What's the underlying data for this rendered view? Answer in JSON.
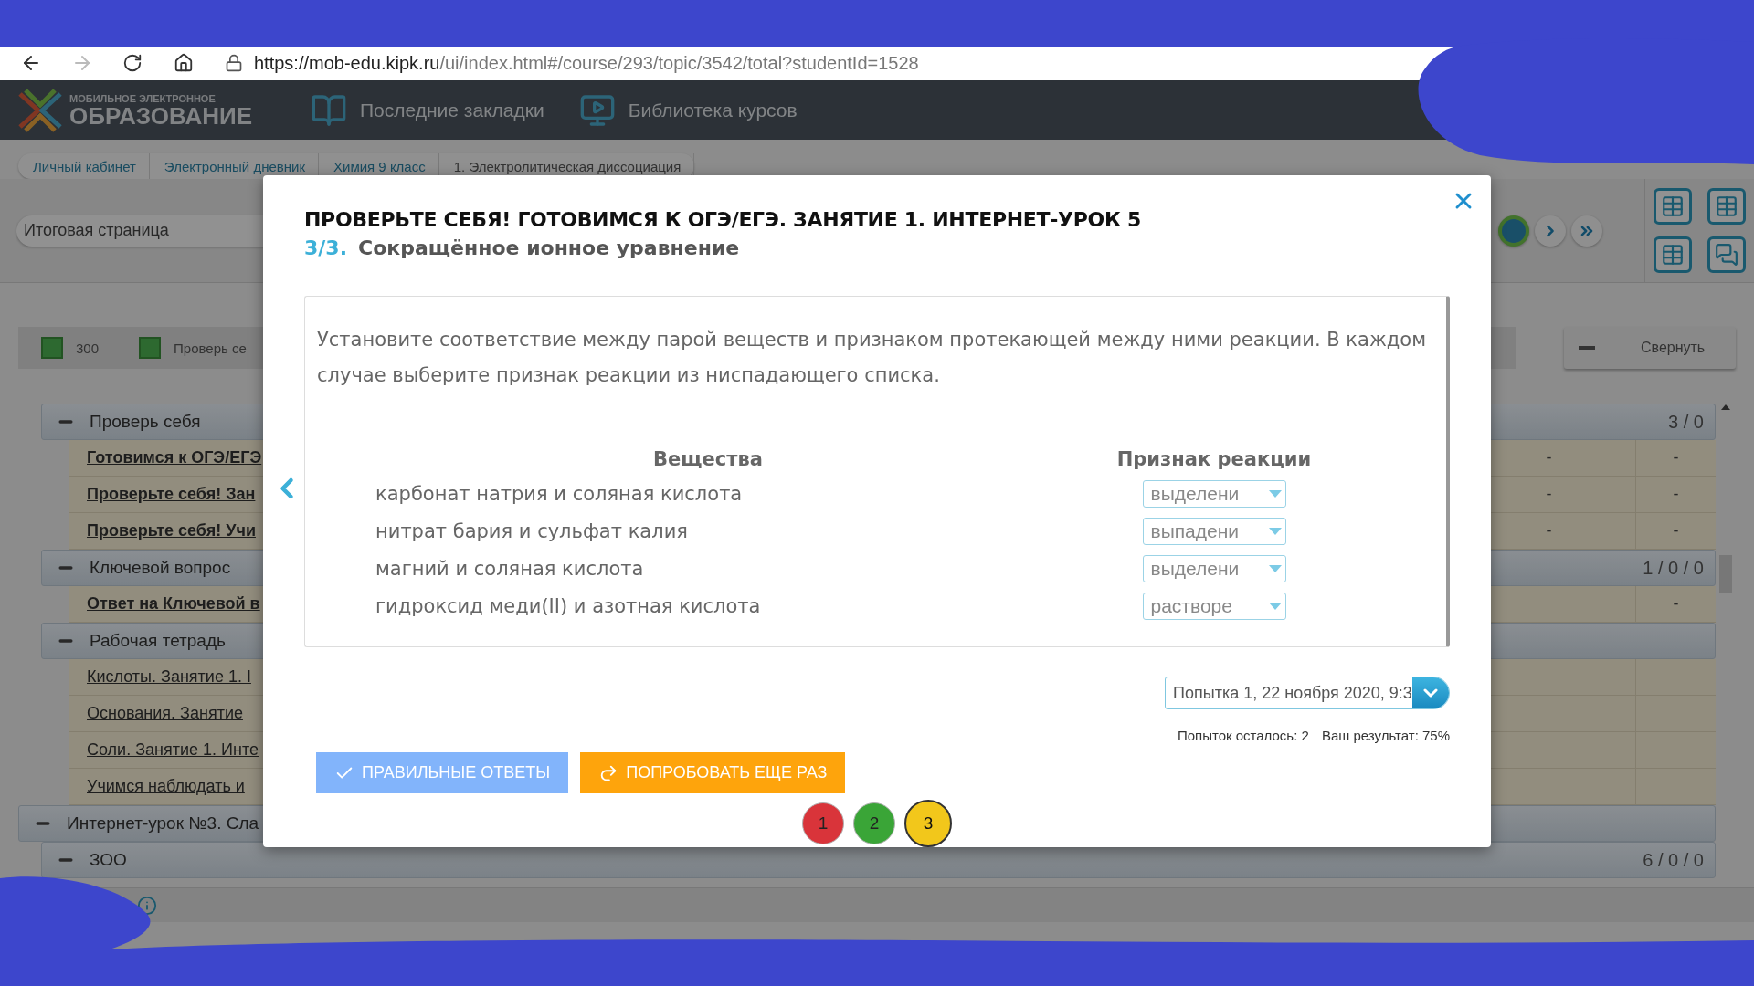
{
  "browser": {
    "url_host": "https://mob-edu.kipk.ru",
    "url_path": "/ui/index.html#/course/293/topic/3542/total?studentId=1528"
  },
  "header": {
    "logo_top": "МОБИЛЬНОЕ ЭЛЕКТРОННОЕ",
    "logo_bottom": "ОБРАЗОВАНИЕ",
    "nav": [
      {
        "kind": "bookmarks",
        "label": "Последние закладки"
      },
      {
        "kind": "library",
        "label": "Библиотека курсов"
      }
    ]
  },
  "breadcrumbs": [
    {
      "label": "Личный кабинет",
      "current": false
    },
    {
      "label": "Электронный дневник",
      "current": false
    },
    {
      "label": "Химия 9 класс",
      "current": false
    },
    {
      "label": "1. Электролитическая диссоциация",
      "current": true
    }
  ],
  "page_select": {
    "value": "Итоговая страница"
  },
  "legend": [
    {
      "label": "300"
    },
    {
      "label": "Проверь се"
    }
  ],
  "collapse_button": "Свернуть",
  "tree": {
    "continued": [
      {
        "label": "Проверь себя",
        "expanded": true,
        "count": "3 / 0",
        "children": [
          {
            "label": "Готовимся к ОГЭ/ЕГЭ",
            "bold": true,
            "col_1": "-",
            "col_2": "-"
          },
          {
            "label": "Проверьте себя! Зан",
            "bold": true,
            "col_1": "-",
            "col_2": "-"
          },
          {
            "label": "Проверьте себя! Учи",
            "bold": true,
            "col_1": "-",
            "col_2": "-"
          }
        ]
      },
      {
        "label": "Ключевой вопрос",
        "expanded": true,
        "count": "1 / 0 / 0",
        "children": [
          {
            "label": "Ответ на Ключевой в",
            "bold": true,
            "col_2": "-"
          }
        ]
      },
      {
        "label": "Рабочая тетрадь",
        "expanded": true,
        "children": [
          {
            "label": "Кислоты. Занятие 1. I",
            "bold": false
          },
          {
            "label": "Основания. Занятие",
            "bold": false
          },
          {
            "label": "Соли. Занятие 1. Инте",
            "bold": false
          },
          {
            "label": "Учимся наблюдать и",
            "bold": false
          }
        ]
      }
    ],
    "items": [
      {
        "label": "Интернет-урок №3. Сла",
        "expanded": true,
        "children": [
          {
            "label": "ЗОО",
            "expanded": true,
            "count": "6 / 0 / 0"
          }
        ]
      }
    ]
  },
  "modal": {
    "title": "ПРОВЕРЬТЕ СЕБЯ! ГОТОВИМСЯ К ОГЭ/ЕГЭ. ЗАНЯТИЕ 1. ИНТЕРНЕТ-УРОК 5",
    "step": "3/3.",
    "subtitle": "Сокращённое ионное уравнение",
    "question": "Установите соответствие между парой веществ и признаком протекающей между ними реакции. В каждом случае выберите признак реакции из ниспадающего списка.",
    "columns": [
      "Вещества",
      "Признак реакции"
    ],
    "rows": [
      {
        "substance": "карбонат натрия и соляная кислота",
        "answer": "выделени"
      },
      {
        "substance": "нитрат бария и сульфат калия",
        "answer": "выпадени"
      },
      {
        "substance": "магний и соляная кислота",
        "answer": "выделени"
      },
      {
        "substance": "гидроксид меди(II) и азотная кислота",
        "answer": "растворе"
      }
    ],
    "attempt_select": "Попытка 1, 22 ноября 2020, 9:3",
    "attempts_left": "Попыток осталось: 2",
    "result": "Ваш результат: 75%",
    "buttons": [
      {
        "kind": "answers",
        "label": "ПРАВИЛЬНЫЕ ОТВЕТЫ"
      },
      {
        "kind": "retry",
        "label": "ПОПРОБОВАТЬ ЕЩЕ РАЗ"
      }
    ],
    "attempts": [
      {
        "label": "1",
        "color": "#d9343a",
        "selected": false
      },
      {
        "label": "2",
        "color": "#3aa537",
        "selected": false
      },
      {
        "label": "3",
        "color": "#f2c71b",
        "selected": true
      }
    ]
  }
}
